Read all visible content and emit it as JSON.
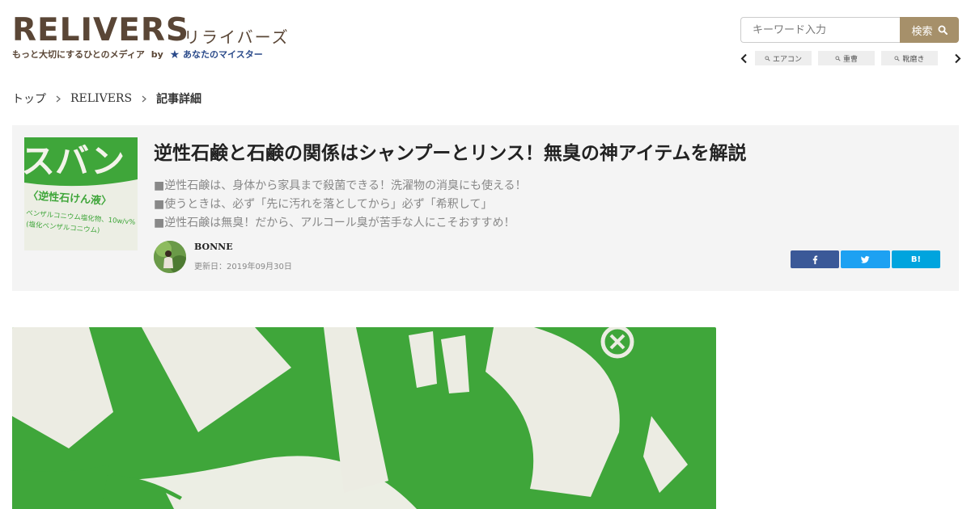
{
  "header": {
    "logo_word": "RELIVERS",
    "logo_kana": "リライバーズ",
    "logo_tagline": "もっと大切にするひとのメディア",
    "logo_by": "by",
    "logo_brand": "あなたのマイスター"
  },
  "search": {
    "placeholder": "キーワード入力",
    "button_label": "検索"
  },
  "tags": [
    {
      "label": "エアコン"
    },
    {
      "label": "重曹"
    },
    {
      "label": "靴磨き"
    }
  ],
  "breadcrumb": {
    "items": [
      "トップ",
      "RELIVERS"
    ],
    "current": "記事詳細"
  },
  "article": {
    "title": "逆性石鹸と石鹸の関係はシャンプーとリンス！無臭の神アイテムを解説",
    "summary": [
      "■逆性石鹸は、身体から家具まで殺菌できる！洗濯物の消臭にも使える！",
      "■使うときは、必ず「先に汚れを落としてから」必ず「希釈して」",
      "■逆性石鹸は無臭！だから、アルコール臭が苦手な人にこそおすすめ！"
    ],
    "author": "BONNE",
    "updated": "更新日：2019年09月30日",
    "thumb_text": {
      "big": "スバン",
      "sub": "〈逆性石けん液〉",
      "line1": "ベンザルコニウム塩化物、10w/v%",
      "line2": "(塩化ベンザルコニウム)"
    }
  },
  "share": {
    "hatena_label": "B!"
  },
  "colors": {
    "brand_brown": "#5a4636",
    "search_button": "#a6906a",
    "card_bg": "#f4f4f4",
    "facebook": "#3b5998",
    "twitter": "#1da1f2",
    "hatena": "#00a4de",
    "product_green": "#3fa63a"
  }
}
